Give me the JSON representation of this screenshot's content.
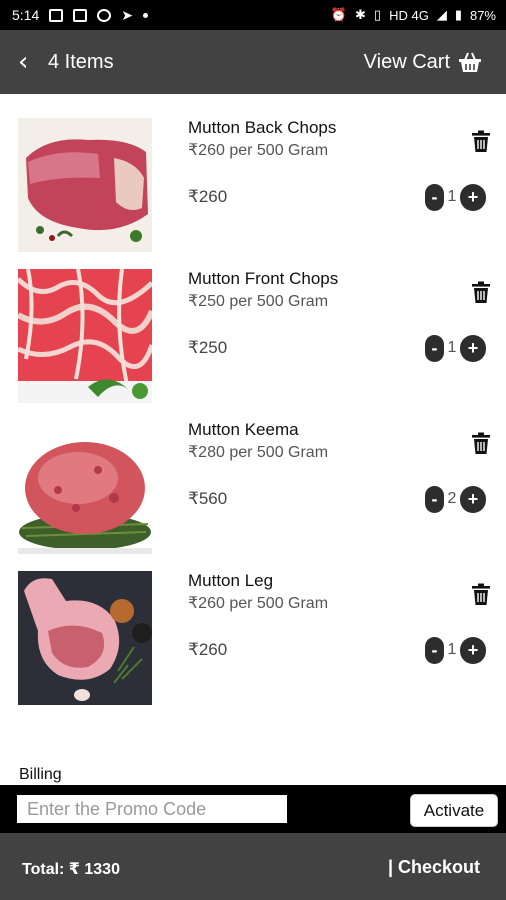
{
  "status_bar": {
    "time": "5:14",
    "network": "HD 4G",
    "battery": "87%"
  },
  "app_bar": {
    "item_count": "4 Items",
    "view_cart_label": "View Cart"
  },
  "cart_items": [
    {
      "name": "Mutton Back Chops",
      "unit_price": "₹260 per 500 Gram",
      "price": "₹260",
      "quantity": "1"
    },
    {
      "name": "Mutton Front Chops",
      "unit_price": "₹250 per 500 Gram",
      "price": "₹250",
      "quantity": "1"
    },
    {
      "name": "Mutton Keema",
      "unit_price": "₹280 per 500 Gram",
      "price": "₹560",
      "quantity": "2"
    },
    {
      "name": "Mutton Leg",
      "unit_price": "₹260 per 500 Gram",
      "price": "₹260",
      "quantity": "1"
    }
  ],
  "qty_controls": {
    "minus": "-",
    "plus": "+"
  },
  "billing": {
    "heading": "Billing"
  },
  "promo": {
    "placeholder": "Enter the Promo Code",
    "activate_label": "Activate"
  },
  "bottom_bar": {
    "total_label": "Total: ₹ 1330",
    "checkout_label": "| Checkout"
  },
  "colors": {
    "app_bar": "#424242",
    "status_bar": "#000000",
    "promo_bar": "#000000",
    "qty_button": "#2d2d2d"
  }
}
